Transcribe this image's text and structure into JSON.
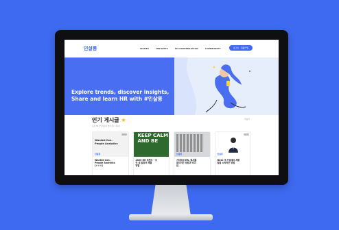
{
  "header": {
    "logo": "인살롱",
    "nav": [
      "ISSUES",
      "INSIGHTS",
      "IN CONVERSATION",
      "COMMUNITY"
    ],
    "login_label": "로그인 · 회원가입"
  },
  "hero": {
    "line1": "Explore trends, discover insights,",
    "line2": "Share and learn HR with #인살롱"
  },
  "section": {
    "title": "인기 게시글",
    "subtitle": "요즘 HR 담당자들이 많이 읽는 게시글",
    "more": "더보기"
  },
  "cards": [
    {
      "thumb_title": "Wanted Con.\nPeople Analytics",
      "brand": "인살롱",
      "title": "Wanted Con.\nPeople Analytics\n[ㅇㅇㅇ]"
    },
    {
      "thumb_title": "KEEP CALM AND BE",
      "brand": "",
      "title": "2020 HR 트렌드 - 조\n직 내 갈등의 해결\n방법"
    },
    {
      "thumb_title": "",
      "brand": "인살롱",
      "title": "스타트업 HR, 회사를\n움직이는 방법과 리더\n십"
    },
    {
      "thumb_title": "",
      "brand": "인살롱",
      "title": "Next IT 기업에서 채용\n일을 시작하는 방법"
    }
  ],
  "colors": {
    "accent": "#3d6af0",
    "background": "#3d6af0"
  }
}
